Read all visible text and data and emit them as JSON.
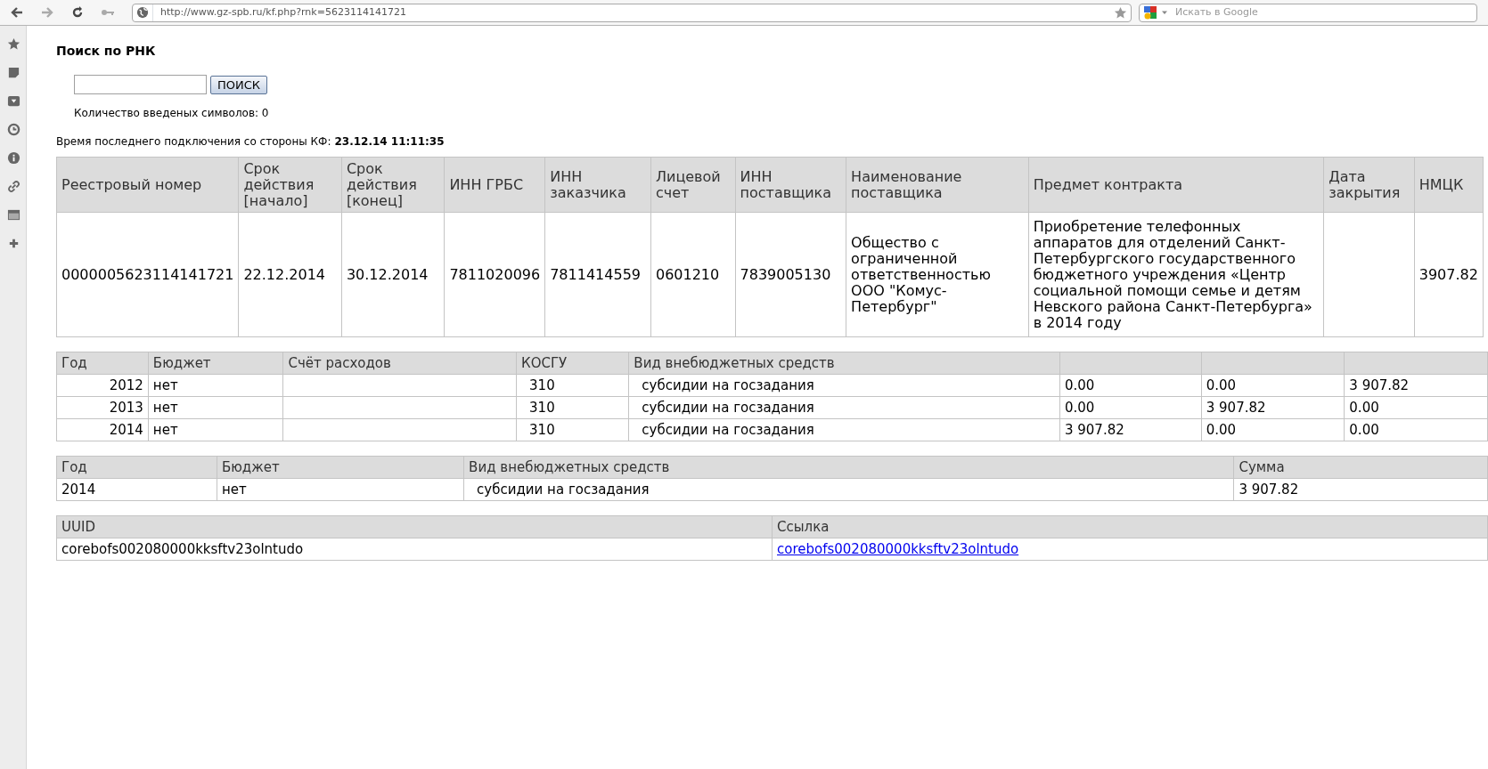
{
  "browser": {
    "url": "http://www.gz-spb.ru/kf.php?rnk=5623114141721",
    "search_placeholder": "Искать в Google"
  },
  "search": {
    "title": "Поиск по РНК",
    "button": "ПОИСК",
    "counter": "Количество введеных символов: 0"
  },
  "last_connection": {
    "label": "Время последнего подключения со стороны КФ:",
    "value": "23.12.14 11:11:35"
  },
  "contract_table": {
    "columns": [
      "Реестровый номер",
      "Срок действия [начало]",
      "Срок действия [конец]",
      "ИНН ГРБС",
      "ИНН заказчика",
      "Лицевой счет",
      "ИНН поставщика",
      "Наименование поставщика",
      "Предмет контракта",
      "Дата закрытия",
      "НМЦК"
    ],
    "rows": [
      [
        "0000005623114141721",
        "22.12.2014",
        "30.12.2014",
        "7811020096",
        "7811414559",
        "0601210",
        "7839005130",
        "Общество с ограниченной ответственностью ООО \"Комус-Петербург\"",
        "Приобретение телефонных аппаратов для отделений Санкт-Петербургского государственного бюджетного учреждения «Центр социальной помощи семье и детям Невского района Санкт-Петербурга» в 2014 году",
        "",
        "3907.82"
      ]
    ]
  },
  "budget_table": {
    "columns": [
      "Год",
      "Бюджет",
      "Счёт расходов",
      "КОСГУ",
      "Вид внебюджетных средств"
    ],
    "rows": [
      [
        "2012",
        "нет",
        "",
        "310",
        "субсидии на госзадания",
        "0.00",
        "0.00",
        "3 907.82"
      ],
      [
        "2013",
        "нет",
        "",
        "310",
        "субсидии на госзадания",
        "0.00",
        "3 907.82",
        "0.00"
      ],
      [
        "2014",
        "нет",
        "",
        "310",
        "субсидии на госзадания",
        "3 907.82",
        "0.00",
        "0.00"
      ]
    ]
  },
  "sum_table": {
    "columns": [
      "Год",
      "Бюджет",
      "Вид внебюджетных средств",
      "Сумма"
    ],
    "rows": [
      [
        "2014",
        "нет",
        "субсидии на госзадания",
        "3 907.82"
      ]
    ]
  },
  "link_table": {
    "columns": [
      {
        "label": "UUID",
        "kind": "text"
      },
      {
        "label": "Ссылка",
        "kind": "link"
      }
    ],
    "rows": [
      [
        "corebofs002080000kksftv23olntudo",
        "corebofs002080000kksftv23olntudo"
      ]
    ]
  }
}
